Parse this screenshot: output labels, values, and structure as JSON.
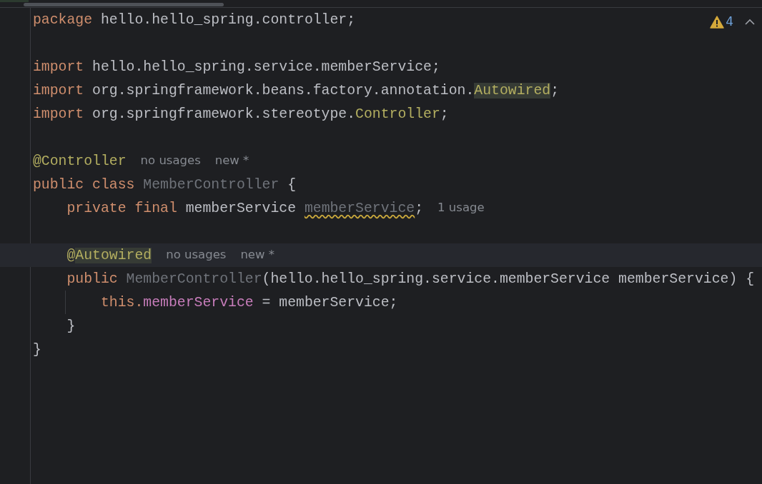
{
  "editor": {
    "inspections": {
      "count": "4"
    },
    "lines": [
      {
        "current": false,
        "tokens": [
          {
            "kind": "keyword",
            "text": "package"
          },
          {
            "kind": "plain",
            "text": " hello.hello_spring.controller;"
          }
        ]
      },
      {
        "current": false
      },
      {
        "current": false,
        "tokens": [
          {
            "kind": "keyword",
            "text": "import"
          },
          {
            "kind": "plain",
            "text": " hello.hello_spring.service.memberService;"
          }
        ]
      },
      {
        "current": false,
        "tokens": [
          {
            "kind": "keyword",
            "text": "import"
          },
          {
            "kind": "plain",
            "text": " org.springframework.beans.factory.annotation."
          },
          {
            "kind": "match",
            "text": "Autowired"
          },
          {
            "kind": "plain",
            "text": ";"
          }
        ]
      },
      {
        "current": false,
        "tokens": [
          {
            "kind": "keyword",
            "text": "import"
          },
          {
            "kind": "plain",
            "text": " org.springframework.stereotype."
          },
          {
            "kind": "annotation",
            "text": "Controller"
          },
          {
            "kind": "plain",
            "text": ";"
          }
        ]
      },
      {
        "current": false
      },
      {
        "current": false,
        "tokens": [
          {
            "kind": "annotation",
            "text": "@Controller"
          },
          {
            "kind": "hint",
            "text": "no usages"
          },
          {
            "kind": "hint",
            "text": "new *"
          }
        ]
      },
      {
        "current": false,
        "tokens": [
          {
            "kind": "keyword",
            "text": "public class "
          },
          {
            "kind": "unused",
            "text": "MemberController"
          },
          {
            "kind": "plain",
            "text": " {"
          }
        ]
      },
      {
        "current": false,
        "tokens": [
          {
            "kind": "keyword",
            "text": "    private final "
          },
          {
            "kind": "plain",
            "text": "memberService "
          },
          {
            "kind": "warned",
            "text": "memberService"
          },
          {
            "kind": "plain",
            "text": ";"
          },
          {
            "kind": "hint",
            "text": "1 usage"
          }
        ]
      },
      {
        "current": false
      },
      {
        "current": true,
        "tokens": [
          {
            "kind": "annotation",
            "text": "    @"
          },
          {
            "kind": "match",
            "text": "Autowired"
          },
          {
            "kind": "hint",
            "text": "no usages"
          },
          {
            "kind": "hint",
            "text": "new *"
          }
        ]
      },
      {
        "current": false,
        "tokens": [
          {
            "kind": "keyword",
            "text": "    public "
          },
          {
            "kind": "unused",
            "text": "MemberController"
          },
          {
            "kind": "plain",
            "text": "(hello.hello_spring.service.memberService memberService) {"
          }
        ]
      },
      {
        "current": false,
        "tokens": [
          {
            "kind": "keyword",
            "text": "        this."
          },
          {
            "kind": "field",
            "text": "memberService"
          },
          {
            "kind": "plain",
            "text": " = memberService;"
          }
        ]
      },
      {
        "current": false,
        "tokens": [
          {
            "kind": "plain",
            "text": "    }"
          }
        ]
      },
      {
        "current": false,
        "tokens": [
          {
            "kind": "plain",
            "text": "}"
          }
        ]
      }
    ]
  }
}
